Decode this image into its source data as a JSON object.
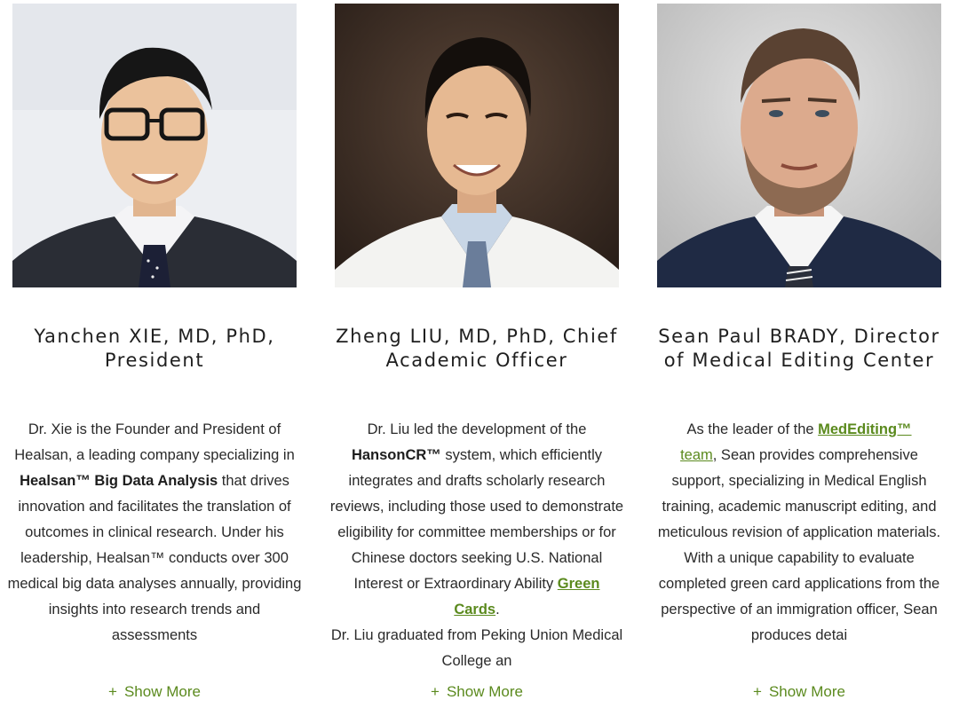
{
  "colors": {
    "accent": "#5b8a1e",
    "text": "#222222"
  },
  "show_more_icon": "plus-icon",
  "members": [
    {
      "name": "Yanchen XIE, MD, PhD, President",
      "bio": {
        "p1": "Dr. Xie is the Founder and President of Healsan, a leading company specializing in ",
        "b1": "Healsan™ Big Data Analysis",
        "p2": " that drives innovation and facilitates the translation of outcomes in clinical research. Under his leadership, Healsan™ conducts over 300 medical big data analyses annually, providing insights into research trends and assessments"
      },
      "show_more": "Show More"
    },
    {
      "name": "Zheng LIU, MD, PhD, Chief Academic Officer",
      "bio": {
        "p1": "Dr. Liu led the development of the ",
        "b1": "HansonCR™",
        "p2": " system, which efficiently integrates and drafts scholarly research reviews, including those used to demonstrate eligibility for committee memberships or for Chinese doctors seeking U.S. National Interest or Extraordinary Ability ",
        "link": "Green Cards",
        "p3": ".",
        "p4": "Dr. Liu graduated from Peking Union Medical College an"
      },
      "show_more": "Show More"
    },
    {
      "name": "Sean Paul BRADY, Director of Medical Editing Center",
      "bio": {
        "p1": "As the leader of the ",
        "link1": "MedEditing™",
        "link2": "team",
        "p2": ", Sean provides comprehensive support, specializing in Medical English training, academic manuscript editing, and meticulous revision of application materials. With a unique capability to evaluate completed green card applications from the perspective of an immigration officer, Sean produces detai"
      },
      "show_more": "Show More"
    }
  ]
}
